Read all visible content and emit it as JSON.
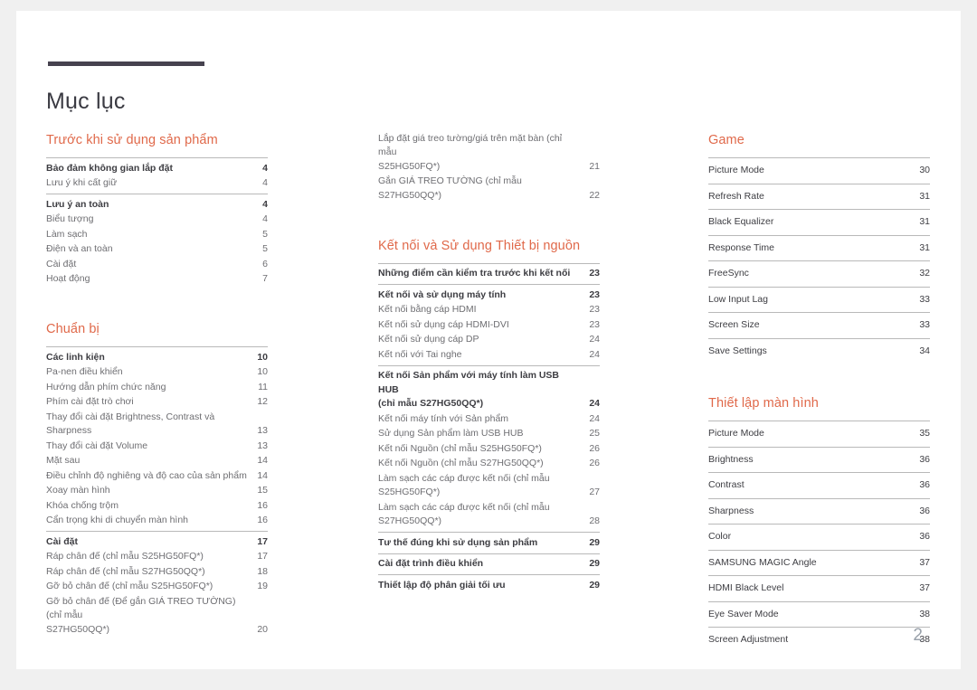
{
  "page": {
    "title": "Mục lục",
    "number": "2",
    "accent_color": "#e0694a",
    "rule_color": "#46424f"
  },
  "columns": {
    "left": [
      {
        "title": "Trước khi sử dụng sản phẩm",
        "groups": [
          {
            "entries": [
              {
                "label": "Bảo đảm không gian lắp đặt",
                "page": "4",
                "main": true
              },
              {
                "label": "Lưu ý khi cất giữ",
                "page": "4",
                "main": false
              }
            ]
          },
          {
            "entries": [
              {
                "label": "Lưu ý an toàn",
                "page": "4",
                "main": true
              },
              {
                "label": "Biểu tượng",
                "page": "4",
                "main": false
              },
              {
                "label": "Làm sạch",
                "page": "5",
                "main": false
              },
              {
                "label": "Điện và an toàn",
                "page": "5",
                "main": false
              },
              {
                "label": "Cài đặt",
                "page": "6",
                "main": false
              },
              {
                "label": "Hoạt động",
                "page": "7",
                "main": false
              }
            ]
          }
        ]
      },
      {
        "title": "Chuẩn bị",
        "groups": [
          {
            "entries": [
              {
                "label": "Các linh kiện",
                "page": "10",
                "main": true
              },
              {
                "label": "Pa-nen điều khiển",
                "page": "10",
                "main": false
              },
              {
                "label": "Hướng dẫn phím chức năng",
                "page": "11",
                "main": false
              },
              {
                "label": "Phím cài đặt trò chơi",
                "page": "12",
                "main": false
              },
              {
                "label": "Thay đổi cài đặt Brightness, Contrast và Sharpness",
                "page": "13",
                "main": false
              },
              {
                "label": "Thay đổi cài đặt Volume",
                "page": "13",
                "main": false
              },
              {
                "label": "Mặt sau",
                "page": "14",
                "main": false
              },
              {
                "label": "Điều chỉnh độ nghiêng và độ cao của sản phẩm",
                "page": "14",
                "main": false
              },
              {
                "label": "Xoay màn hình",
                "page": "15",
                "main": false
              },
              {
                "label": "Khóa chống trộm",
                "page": "16",
                "main": false
              },
              {
                "label": "Cẩn trọng khi di chuyển màn hình",
                "page": "16",
                "main": false
              }
            ]
          },
          {
            "entries": [
              {
                "label": "Cài đặt",
                "page": "17",
                "main": true
              },
              {
                "label": "Ráp chân đế (chỉ mẫu S25HG50FQ*)",
                "page": "17",
                "main": false
              },
              {
                "label": "Ráp chân đế (chỉ mẫu S27HG50QQ*)",
                "page": "18",
                "main": false
              },
              {
                "label": "Gỡ bỏ chân đế (chỉ mẫu S25HG50FQ*)",
                "page": "19",
                "main": false
              },
              {
                "label": "Gỡ bỏ chân đế (Để gắn GIÁ TREO TƯỜNG) (chỉ mẫu\nS27HG50QQ*)",
                "page": "20",
                "main": false,
                "wrap": true
              }
            ]
          }
        ]
      }
    ],
    "middle": [
      {
        "title": "",
        "groups": [
          {
            "nobar": true,
            "entries": [
              {
                "label": "Lắp đặt giá treo tường/giá trên mặt bàn (chỉ mẫu\nS25HG50FQ*)",
                "page": "21",
                "main": false,
                "wrap": true
              },
              {
                "label": "Gắn GIÁ TREO TƯỜNG (chỉ mẫu S27HG50QQ*)",
                "page": "22",
                "main": false
              }
            ]
          }
        ]
      },
      {
        "title": "Kết nối và Sử dụng Thiết bị nguồn",
        "groups": [
          {
            "entries": [
              {
                "label": "Những điểm cần kiểm tra trước khi kết nối",
                "page": "23",
                "main": true
              }
            ]
          },
          {
            "entries": [
              {
                "label": "Kết nối và sử dụng máy tính",
                "page": "23",
                "main": true
              },
              {
                "label": "Kết nối bằng cáp HDMI",
                "page": "23",
                "main": false
              },
              {
                "label": "Kết nối sử dụng cáp HDMI-DVI",
                "page": "23",
                "main": false
              },
              {
                "label": "Kết nối sử dụng cáp DP",
                "page": "24",
                "main": false
              },
              {
                "label": "Kết nối với Tai nghe",
                "page": "24",
                "main": false
              }
            ]
          },
          {
            "entries": [
              {
                "label": "Kết nối Sản phẩm với máy tính làm USB HUB\n(chỉ mẫu S27HG50QQ*)",
                "page": "24",
                "main": true,
                "wrap": true
              },
              {
                "label": "Kết nối máy tính với Sản phẩm",
                "page": "24",
                "main": false
              },
              {
                "label": "Sử dụng Sản phẩm làm USB HUB",
                "page": "25",
                "main": false
              },
              {
                "label": "Kết nối Nguồn (chỉ mẫu S25HG50FQ*)",
                "page": "26",
                "main": false
              },
              {
                "label": "Kết nối Nguồn (chỉ mẫu S27HG50QQ*)",
                "page": "26",
                "main": false
              },
              {
                "label": "Làm sạch các cáp được kết nối (chỉ mẫu\nS25HG50FQ*)",
                "page": "27",
                "main": false,
                "wrap": true
              },
              {
                "label": "Làm sạch các cáp được kết nối (chỉ mẫu\nS27HG50QQ*)",
                "page": "28",
                "main": false,
                "wrap": true
              }
            ]
          },
          {
            "entries": [
              {
                "label": "Tư thế đúng khi sử dụng sản phẩm",
                "page": "29",
                "main": true
              }
            ]
          },
          {
            "entries": [
              {
                "label": "Cài đặt trình điều khiển",
                "page": "29",
                "main": true
              }
            ]
          },
          {
            "entries": [
              {
                "label": "Thiết lập độ phân giải tối ưu",
                "page": "29",
                "main": true
              }
            ]
          }
        ]
      }
    ],
    "right": [
      {
        "title": "Game",
        "ruled": true,
        "entries": [
          {
            "label": "Picture Mode",
            "page": "30"
          },
          {
            "label": "Refresh Rate",
            "page": "31"
          },
          {
            "label": "Black Equalizer",
            "page": "31"
          },
          {
            "label": "Response Time",
            "page": "31"
          },
          {
            "label": "FreeSync",
            "page": "32"
          },
          {
            "label": "Low Input Lag",
            "page": "33"
          },
          {
            "label": "Screen Size",
            "page": "33"
          },
          {
            "label": "Save Settings",
            "page": "34"
          }
        ]
      },
      {
        "title": "Thiết lập màn hình",
        "ruled": true,
        "entries": [
          {
            "label": "Picture Mode",
            "page": "35"
          },
          {
            "label": "Brightness",
            "page": "36"
          },
          {
            "label": "Contrast",
            "page": "36"
          },
          {
            "label": "Sharpness",
            "page": "36"
          },
          {
            "label": "Color",
            "page": "36"
          },
          {
            "label": "SAMSUNG MAGIC Angle",
            "page": "37"
          },
          {
            "label": "HDMI Black Level",
            "page": "37"
          },
          {
            "label": "Eye Saver Mode",
            "page": "38"
          },
          {
            "label": "Screen Adjustment",
            "page": "38"
          }
        ]
      }
    ]
  }
}
